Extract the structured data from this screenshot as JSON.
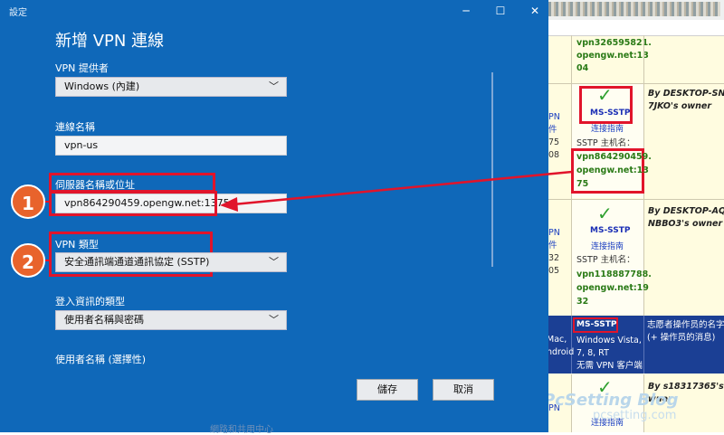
{
  "window": {
    "title": "設定",
    "controls": {
      "minimize": "─",
      "maximize": "☐",
      "close": "✕"
    }
  },
  "dialog": {
    "title": "新增 VPN 連線",
    "provider": {
      "label": "VPN 提供者",
      "value": "Windows (內建)"
    },
    "connection_name": {
      "label": "連線名稱",
      "value": "vpn-us"
    },
    "server": {
      "label": "伺服器名稱或位址",
      "value": "vpn864290459.opengw.net:1375"
    },
    "vpn_type": {
      "label": "VPN 類型",
      "value": "安全通訊端通道通訊協定 (SSTP)"
    },
    "signin_type": {
      "label": "登入資訊的類型",
      "value": "使用者名稱與密碼"
    },
    "username": {
      "label": "使用者名稱 (選擇性)"
    },
    "save": "儲存",
    "cancel": "取消",
    "faded_text": "網路和共用中心"
  },
  "annotations": {
    "step1": "1",
    "step2": "2"
  },
  "background_page": {
    "row0": {
      "host_line1": "vpn326595821.",
      "host_line2": "opengw.net:13",
      "host_line3": "04"
    },
    "row1": {
      "left1": "PN",
      "left2": "件",
      "left3": "75",
      "left4": "08",
      "badge": "MS-SSTP",
      "link": "连接指南",
      "host_label": "SSTP 主机名：",
      "host_line1": "vpn864290459.",
      "host_line2": "opengw.net:13",
      "host_line3": "75",
      "owner1": "By DESKTOP-SNB",
      "owner2": "7JKO's owner"
    },
    "row2": {
      "left1": "PN",
      "left2": "件",
      "left3": "32",
      "left4": "05",
      "badge": "MS-SSTP",
      "link": "连接指南",
      "host_label": "SSTP 主机名：",
      "host_line1": "vpn118887788.",
      "host_line2": "opengw.net:19",
      "host_line3": "32",
      "owner1": "By DESKTOP-AQ",
      "owner2": "NBBO3's owner"
    },
    "header_row": {
      "left1": "Mac,",
      "left2": "ndroid",
      "badge": "MS-SSTP",
      "os1": "Windows Vista,",
      "os2": "7, 8, RT",
      "os3": "无需 VPN 客户端",
      "note1": "志愿者操作员的名字",
      "note2": "(+ 操作员的消息)"
    },
    "row3": {
      "left1": "PN",
      "link": "连接指南",
      "owner1": "By s18317365's o",
      "owner2": "wner"
    },
    "watermark1": "PcSetting Blog",
    "watermark2": "pcsetting.com"
  },
  "colors": {
    "window_bg": "#0f68b9",
    "highlight": "#e1142b",
    "step_circle": "#e8632c",
    "check": "#2ea02e"
  }
}
